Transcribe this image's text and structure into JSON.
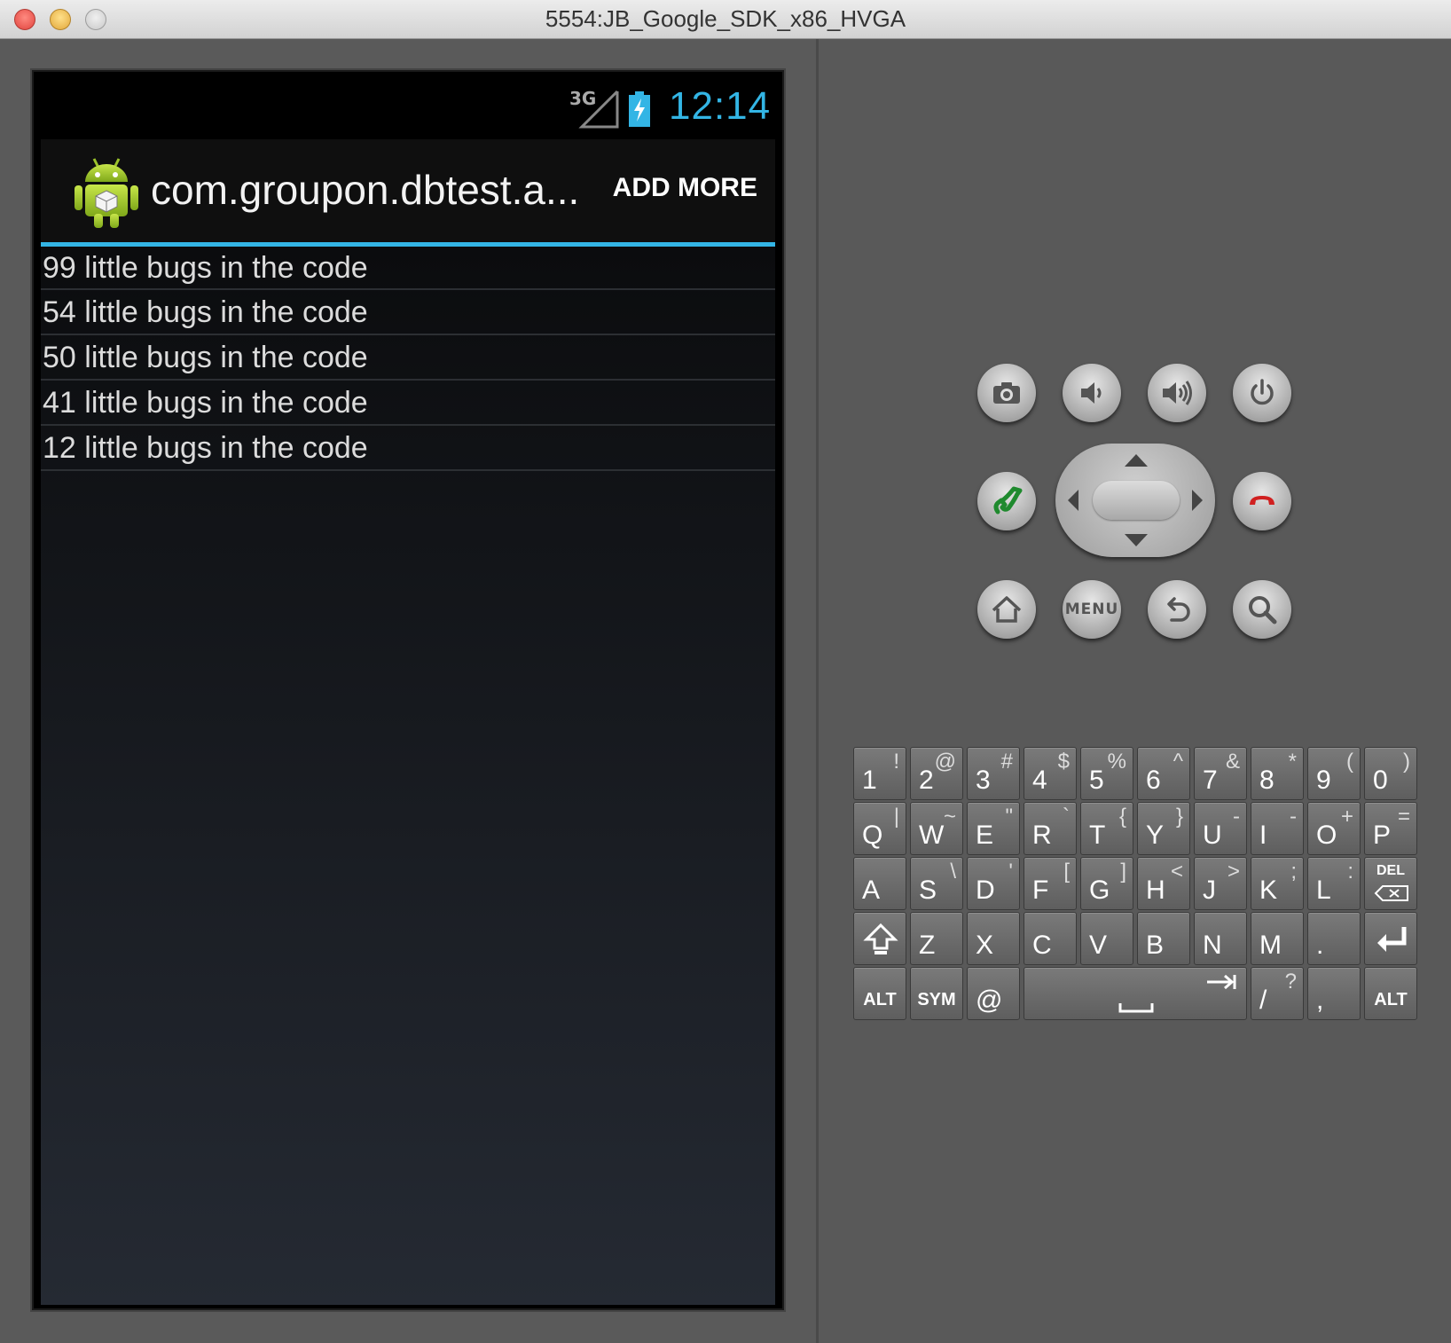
{
  "window": {
    "title": "5554:JB_Google_SDK_x86_HVGA"
  },
  "statusbar": {
    "network": "3G",
    "time": "12:14"
  },
  "actionbar": {
    "title": "com.groupon.dbtest.a...",
    "action_label": "ADD MORE"
  },
  "list": {
    "items": [
      "99 little bugs in the code",
      "54 little bugs in the code",
      "50 little bugs in the code",
      "41 little bugs in the code",
      "12 little bugs in the code"
    ]
  },
  "controls": {
    "menu_label": "MENU",
    "icons": [
      "camera-icon",
      "volume-down-icon",
      "volume-up-icon",
      "power-icon",
      "call-icon",
      "end-call-icon",
      "home-icon",
      "back-icon",
      "search-icon"
    ]
  },
  "keyboard": {
    "row1": [
      [
        "1",
        "!"
      ],
      [
        "2",
        "@"
      ],
      [
        "3",
        "#"
      ],
      [
        "4",
        "$"
      ],
      [
        "5",
        "%"
      ],
      [
        "6",
        "^"
      ],
      [
        "7",
        "&"
      ],
      [
        "8",
        "*"
      ],
      [
        "9",
        "("
      ],
      [
        "0",
        ")"
      ]
    ],
    "row2": [
      [
        "Q",
        "|"
      ],
      [
        "W",
        "~"
      ],
      [
        "E",
        "\""
      ],
      [
        "R",
        "`"
      ],
      [
        "T",
        "{"
      ],
      [
        "Y",
        "}"
      ],
      [
        "U",
        "-"
      ],
      [
        "I",
        "-"
      ],
      [
        "O",
        "+"
      ],
      [
        "P",
        "="
      ]
    ],
    "row3": [
      [
        "A",
        ""
      ],
      [
        "S",
        "\\"
      ],
      [
        "D",
        "'"
      ],
      [
        "F",
        "["
      ],
      [
        "G",
        "]"
      ],
      [
        "H",
        "<"
      ],
      [
        "J",
        ">"
      ],
      [
        "K",
        ";"
      ],
      [
        "L",
        ":"
      ]
    ],
    "row4": [
      [
        "Z",
        ""
      ],
      [
        "X",
        ""
      ],
      [
        "C",
        ""
      ],
      [
        "V",
        ""
      ],
      [
        "B",
        ""
      ],
      [
        "N",
        ""
      ],
      [
        "M",
        ""
      ],
      [
        ".",
        ""
      ]
    ],
    "del_label": "DEL",
    "alt_label": "ALT",
    "sym_label": "SYM",
    "at_label": "@",
    "slash_key": [
      "/",
      "?"
    ],
    "comma_key": ","
  },
  "colors": {
    "accent": "#33b5e5",
    "call_green": "#1f8a2e",
    "end_red": "#d02020"
  }
}
